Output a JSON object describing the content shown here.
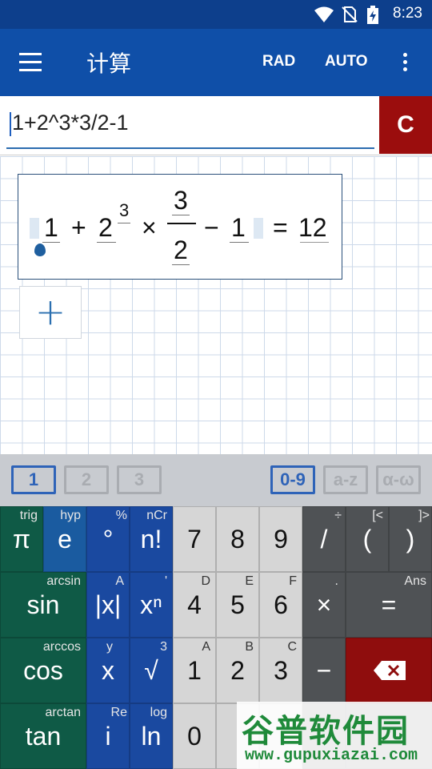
{
  "status_bar": {
    "time": "8:23"
  },
  "app_bar": {
    "title": "计算",
    "angle_mode": "RAD",
    "output_mode": "AUTO"
  },
  "input": {
    "expression": "1+2^3*3/2-1",
    "clear_label": "C"
  },
  "display": {
    "a": "1",
    "plus": "+",
    "base": "2",
    "exponent": "3",
    "times": "×",
    "numerator": "3",
    "denominator": "2",
    "minus": "−",
    "b": "1",
    "equals": "=",
    "result": "12"
  },
  "add_label": "+",
  "keyboard_tabs": [
    "1",
    "2",
    "3",
    "0-9",
    "a-z",
    "α-ω"
  ],
  "keys": {
    "pi": {
      "main": "π",
      "alt": "trig"
    },
    "e": {
      "main": "e",
      "alt": "hyp"
    },
    "deg": {
      "main": "°",
      "alt": "%"
    },
    "fact": {
      "main": "n!",
      "alt": "nCr"
    },
    "sin": {
      "main": "sin",
      "alt": "arcsin"
    },
    "abs": {
      "main": "|x|",
      "alt": "A"
    },
    "pow": {
      "main": "xⁿ",
      "alt": "'"
    },
    "cos": {
      "main": "cos",
      "alt": "arccos"
    },
    "x": {
      "main": "x",
      "alt": "y"
    },
    "sqrt": {
      "main": "√",
      "alt": "3"
    },
    "tan": {
      "main": "tan",
      "alt": "arctan"
    },
    "i": {
      "main": "i",
      "alt": "Re"
    },
    "ln": {
      "main": "ln",
      "alt": "log"
    },
    "k7": {
      "main": "7",
      "alt": ""
    },
    "k8": {
      "main": "8",
      "alt": ""
    },
    "k9": {
      "main": "9",
      "alt": ""
    },
    "k4": {
      "main": "4",
      "alt": "D"
    },
    "k5": {
      "main": "5",
      "alt": "E"
    },
    "k6": {
      "main": "6",
      "alt": "F"
    },
    "k1": {
      "main": "1",
      "alt": "A"
    },
    "k2": {
      "main": "2",
      "alt": "B"
    },
    "k3": {
      "main": "3",
      "alt": "C"
    },
    "k0": {
      "main": "0",
      "alt": ""
    },
    "div": {
      "main": "/",
      "alt": "÷"
    },
    "lpar": {
      "main": "(",
      "alt": "[<"
    },
    "rpar": {
      "main": ")",
      "alt": "]>"
    },
    "mul": {
      "main": "×",
      "alt": "."
    },
    "eq": {
      "main": "=",
      "alt": "Ans"
    },
    "sub": {
      "main": "−",
      "alt": ""
    }
  },
  "watermark": {
    "title": "谷普软件园",
    "url": "www.gupuxiazai.com"
  },
  "colors": {
    "app_bar": "#0f4fa8",
    "clear": "#9b0d0d",
    "function_keys": "#0f5a46",
    "var_keys": "#1a49a0"
  }
}
